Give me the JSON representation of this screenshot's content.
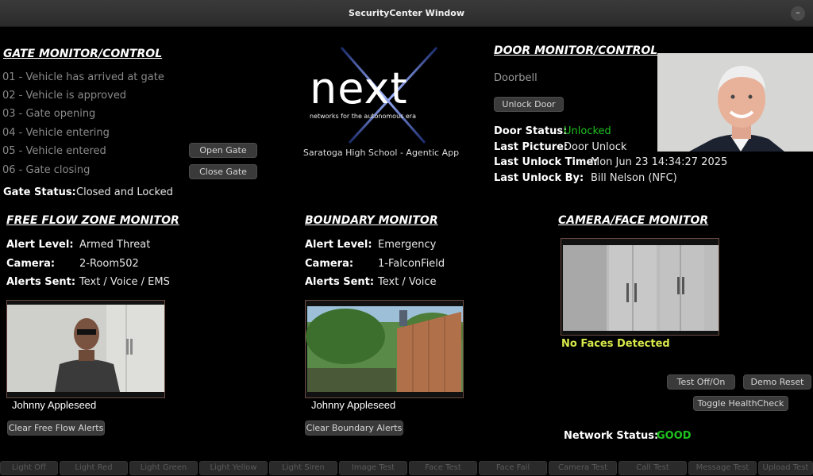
{
  "window": {
    "title": "SecurityCenter Window",
    "minimize_glyph": "–"
  },
  "gate": {
    "title": "GATE MONITOR/CONTROL",
    "steps": [
      "01 - Vehicle has arrived at gate",
      "02 - Vehicle is approved",
      "03 - Gate opening",
      "04 - Vehicle entering",
      "05 - Vehicle entered",
      "06 - Gate closing"
    ],
    "open_label": "Open Gate",
    "close_label": "Close Gate",
    "status_label": "Gate Status:",
    "status_value": "Closed and Locked"
  },
  "logo": {
    "word": "next",
    "tagline": "networks for the autonomous era",
    "subtitle": "Saratoga High School - Agentic App"
  },
  "door": {
    "title": "DOOR MONITOR/CONTROL",
    "doorbell": "Doorbell",
    "unlock_label": "Unlock Door",
    "status_label": "Door Status:",
    "status_value": "Unlocked",
    "picture_label": "Last Picture:",
    "picture_value": "Door Unlock",
    "time_label": "Last Unlock Time:",
    "time_value": "Mon Jun 23 14:34:27 2025",
    "by_label": "Last Unlock By:",
    "by_value": "Bill Nelson (NFC)",
    "status_color": "#1ec21e"
  },
  "freeflow": {
    "title": "FREE FLOW ZONE MONITOR",
    "alert_label": "Alert Level:",
    "alert_value": "Armed Threat",
    "camera_label": "Camera:",
    "camera_value": "2-Room502",
    "sent_label": "Alerts Sent:",
    "sent_value": "Text / Voice / EMS",
    "caption": "Johnny Appleseed",
    "clear_label": "Clear Free Flow Alerts"
  },
  "boundary": {
    "title": "BOUNDARY MONITOR",
    "alert_label": "Alert Level:",
    "alert_value": "Emergency",
    "camera_label": "Camera:",
    "camera_value": "1-FalconField",
    "sent_label": "Alerts Sent:",
    "sent_value": "Text / Voice",
    "caption": "Johnny Appleseed",
    "clear_label": "Clear Boundary Alerts"
  },
  "camera": {
    "title": "CAMERA/FACE MONITOR",
    "status": "No Faces Detected",
    "status_color": "#d7e84a",
    "test_label": "Test Off/On",
    "reset_label": "Demo Reset",
    "health_label": "Toggle HealthCheck"
  },
  "network": {
    "label": "Network Status:",
    "value": "GOOD",
    "value_color": "#1ec21e"
  },
  "bottom_buttons": [
    "Light Off",
    "Light Red",
    "Light Green",
    "Light Yellow",
    "Light Siren",
    "Image Test",
    "Face Test",
    "Face Fail",
    "Camera Test",
    "Call Test",
    "Message Test",
    "Upload Test"
  ]
}
